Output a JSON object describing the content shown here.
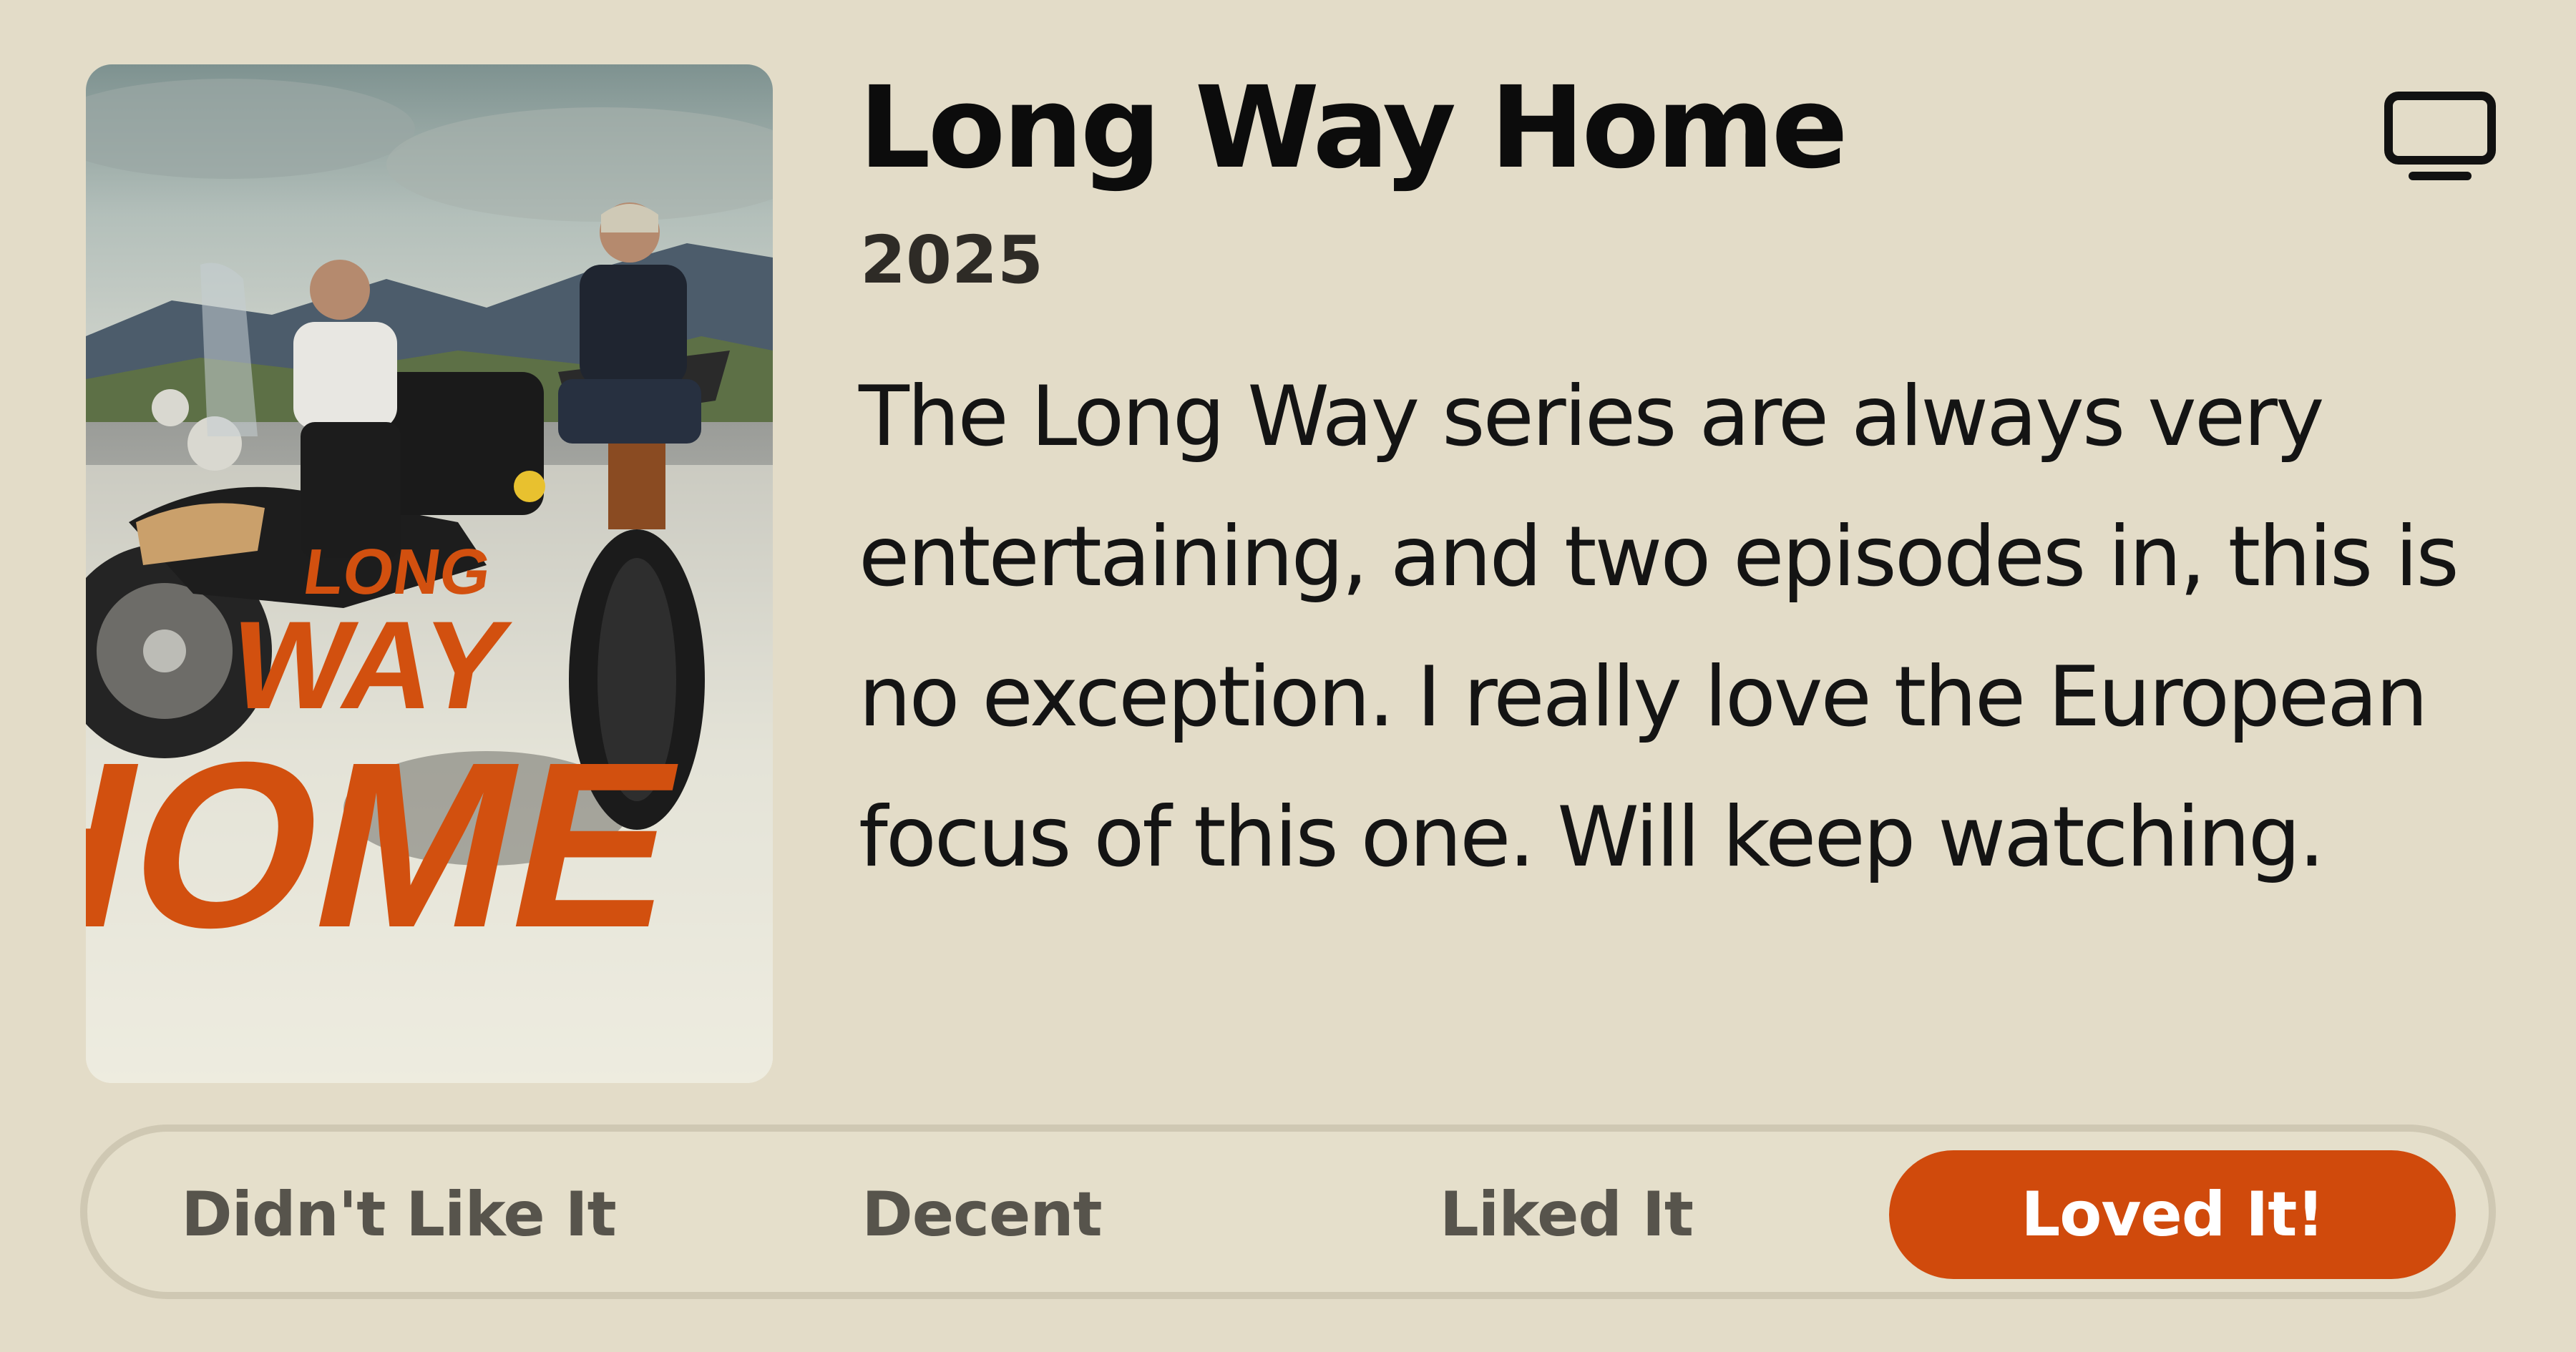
{
  "show": {
    "title": "Long Way Home",
    "year": "2025",
    "review": "The Long Way series are always very entertaining, and two episodes in, this is no exception. I really love the European focus of this one. Will keep watching.",
    "media_type_icon": "tv-icon",
    "poster": {
      "title_lines": [
        "LONG",
        "WAY",
        "HOME"
      ],
      "title_color": "#d2500f"
    }
  },
  "rating": {
    "options": [
      {
        "label": "Didn't Like It",
        "selected": false
      },
      {
        "label": "Decent",
        "selected": false
      },
      {
        "label": "Liked It",
        "selected": false
      },
      {
        "label": "Loved It!",
        "selected": true
      }
    ],
    "selected_color": "#d04a0c"
  },
  "colors": {
    "background": "#e3dcc8",
    "accent": "#d04a0c"
  }
}
